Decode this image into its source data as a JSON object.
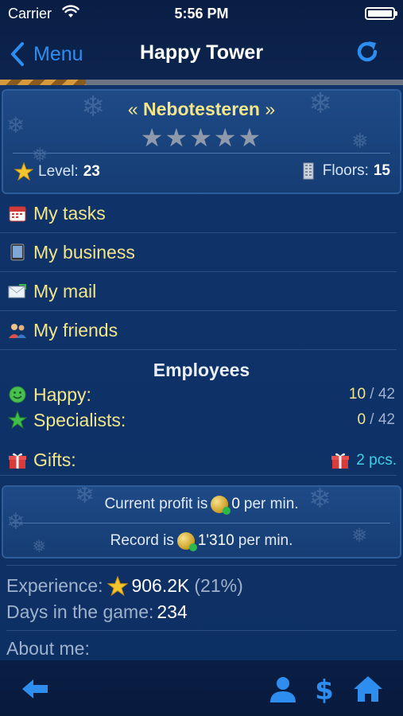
{
  "status_bar": {
    "carrier": "Carrier",
    "time": "5:56 PM"
  },
  "nav": {
    "back_label": "Menu",
    "title": "Happy Tower"
  },
  "profile": {
    "name": "Nebotesteren",
    "quote_left": "«",
    "quote_right": "»",
    "stars_total": 5,
    "stars_filled": 0,
    "level_label": "Level:",
    "level_value": "23",
    "floors_label": "Floors:",
    "floors_value": "15"
  },
  "menu": {
    "items": [
      {
        "label": "My tasks",
        "icon": "calendar-icon"
      },
      {
        "label": "My business",
        "icon": "tablet-icon"
      },
      {
        "label": "My mail",
        "icon": "mail-icon"
      },
      {
        "label": "My friends",
        "icon": "friends-icon"
      }
    ]
  },
  "employees": {
    "title": "Employees",
    "happy_label": "Happy:",
    "happy_current": "10",
    "happy_total": "/ 42",
    "specialists_label": "Specialists:",
    "specialists_current": "0",
    "specialists_total": "/ 42"
  },
  "gifts": {
    "label": "Gifts:",
    "count": "2 pcs."
  },
  "profit": {
    "current_prefix": "Current profit is",
    "current_value": "0",
    "current_suffix": "per min.",
    "record_prefix": "Record is",
    "record_value": "1'310",
    "record_suffix": "per min."
  },
  "stats": {
    "experience_label": "Experience:",
    "experience_value": "906.2K",
    "experience_percent": "(21%)",
    "days_label": "Days in the game:",
    "days_value": "234"
  },
  "about": {
    "label": "About me:"
  },
  "colors": {
    "accent": "#2d8ef0",
    "link_yellow": "#f2e58a",
    "cyan": "#3fd0e8",
    "background": "#0f3369"
  },
  "bottom_bar": {
    "icons": [
      "back-arrow-icon",
      "profile-icon",
      "dollar-icon",
      "home-icon"
    ]
  }
}
